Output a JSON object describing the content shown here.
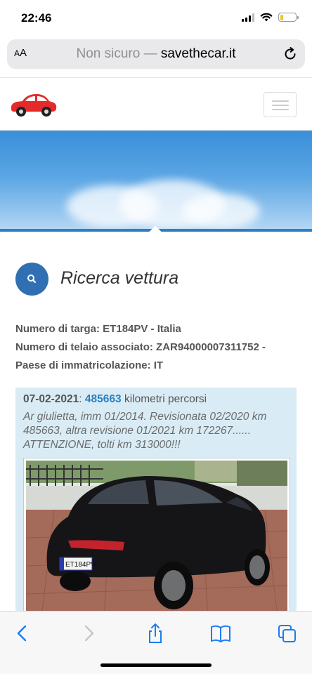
{
  "status": {
    "time": "22:46"
  },
  "browser": {
    "text_size_label_small": "A",
    "text_size_label_big": "A",
    "url_prefix": "Non sicuro — ",
    "url_domain": "savethecar.it"
  },
  "page": {
    "section_title": "Ricerca vettura",
    "plate_line": "Numero di targa: ET184PV - Italia",
    "chassis_line": "Numero di telaio associato: ZAR94000007311752 -",
    "country_line": "Paese di immatricolazione: IT",
    "record": {
      "date": "07-02-2021",
      "separator": ": ",
      "km_value": "485663",
      "km_label": " kilometri percorsi",
      "note": "Ar giulietta, imm 01/2014. Revisionata 02/2020 km 485663, altra revisione 01/2021 km 172267...... ATTENZIONE, tolti km 313000!!!",
      "photo_plate": "ET184PV"
    }
  },
  "colors": {
    "accent": "#2c7fc4",
    "search_button": "#2f6fb2",
    "record_bg": "#d9ecf5",
    "ios_blue": "#1a7cf5"
  }
}
